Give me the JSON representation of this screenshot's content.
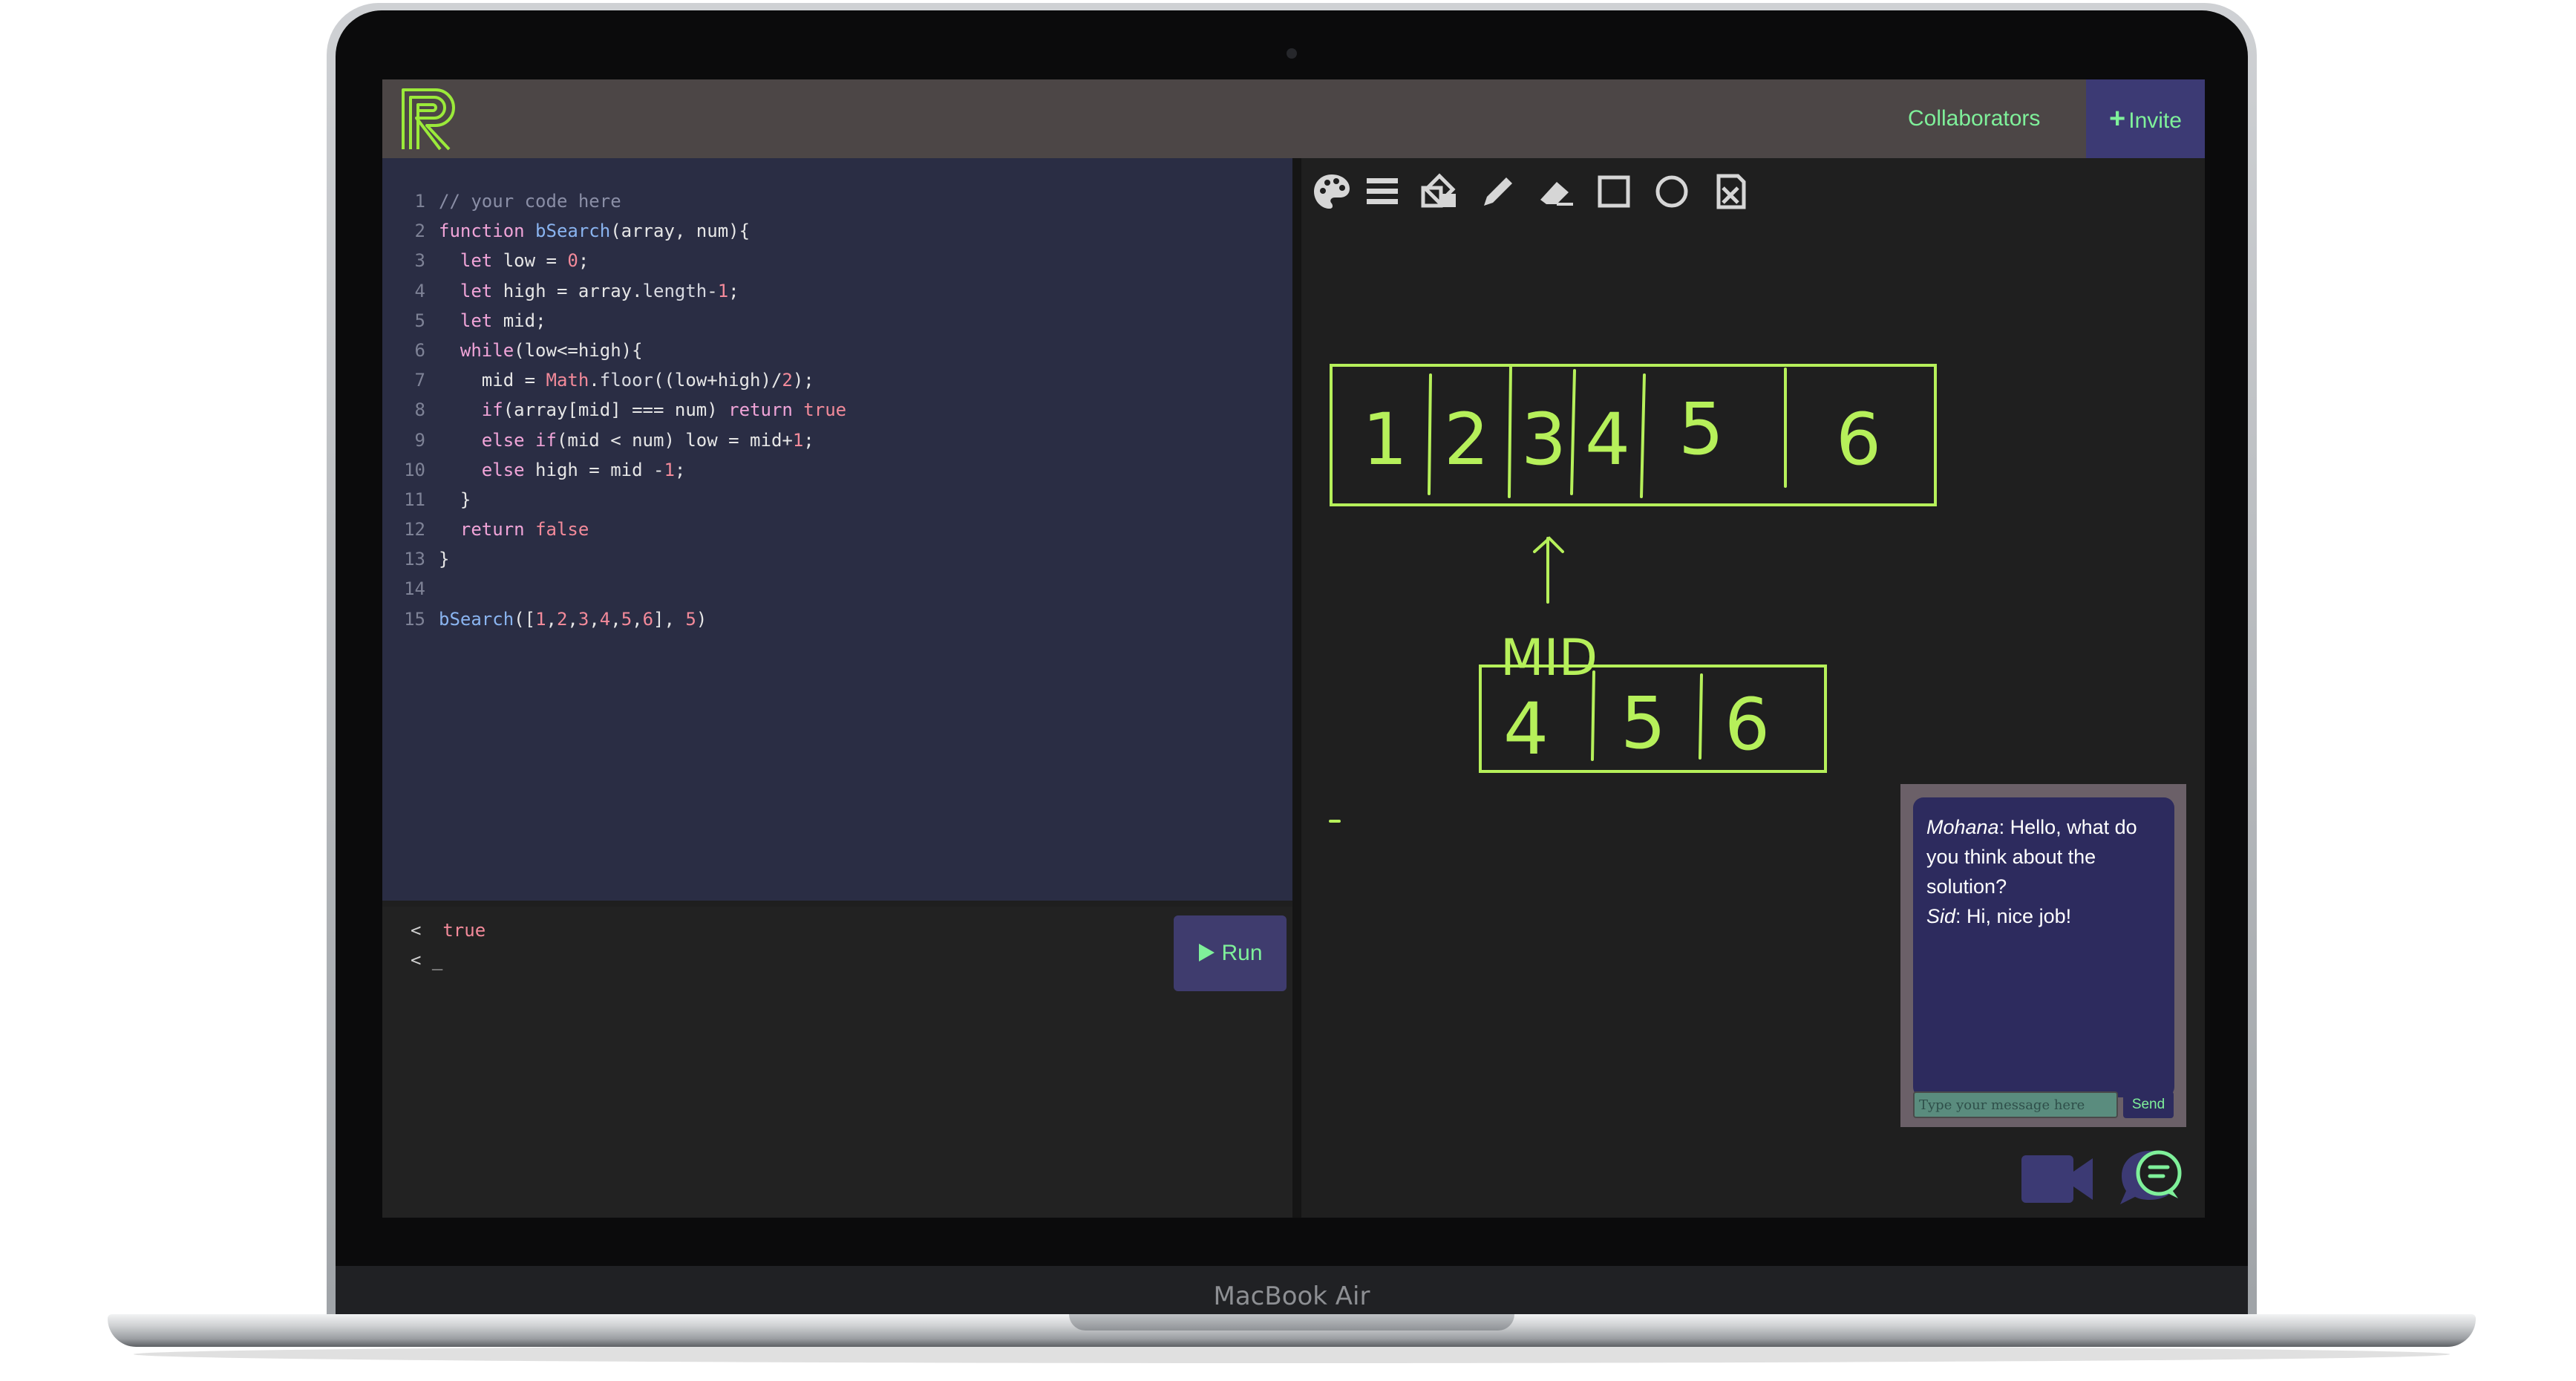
{
  "app": {
    "brand_device": "MacBook Air",
    "logo_letter": "R",
    "header": {
      "collaborators_label": "Collaborators",
      "invite_label": "Invite"
    }
  },
  "editor": {
    "lines": [
      {
        "n": "1",
        "t": "// your code here"
      },
      {
        "n": "2",
        "t": "function bSearch(array, num){"
      },
      {
        "n": "3",
        "t": "  let low = 0;"
      },
      {
        "n": "4",
        "t": "  let high = array.length-1;"
      },
      {
        "n": "5",
        "t": "  let mid;"
      },
      {
        "n": "6",
        "t": "  while(low<=high){"
      },
      {
        "n": "7",
        "t": "    mid = Math.floor((low+high)/2);"
      },
      {
        "n": "8",
        "t": "    if(array[mid] === num) return true"
      },
      {
        "n": "9",
        "t": "    else if(mid < num) low = mid+1;"
      },
      {
        "n": "10",
        "t": "    else high = mid -1;"
      },
      {
        "n": "11",
        "t": "  }"
      },
      {
        "n": "12",
        "t": "  return false"
      },
      {
        "n": "13",
        "t": "}"
      },
      {
        "n": "14",
        "t": ""
      },
      {
        "n": "15",
        "t": "bSearch([1,2,3,4,5,6], 5)"
      }
    ]
  },
  "console": {
    "lines": [
      {
        "prompt": "<",
        "text": "true"
      },
      {
        "prompt": "<",
        "text": "_"
      }
    ],
    "run_label": "Run"
  },
  "whiteboard": {
    "tools": [
      "palette-icon",
      "menu-icon",
      "shapes-icon",
      "pencil-icon",
      "eraser-icon",
      "square-icon",
      "circle-icon",
      "clear-icon"
    ],
    "array_top": [
      "1",
      "2",
      "3",
      "4",
      "5",
      "6"
    ],
    "array_bottom": [
      "4",
      "5",
      "6"
    ],
    "mid_label": "MID",
    "ink_color": "#b6f05a"
  },
  "chat": {
    "messages": [
      {
        "author": "Mohana",
        "text": "Hello, what do you think about the solution?"
      },
      {
        "author": "Sid",
        "text": "Hi, nice job!"
      }
    ],
    "placeholder": "Type your message here",
    "send_label": "Send"
  },
  "colors": {
    "accent_green": "#7ff09a",
    "header_bg": "#4c4646",
    "invite_bg": "#3c3a74",
    "editor_bg": "#2a2d44"
  }
}
